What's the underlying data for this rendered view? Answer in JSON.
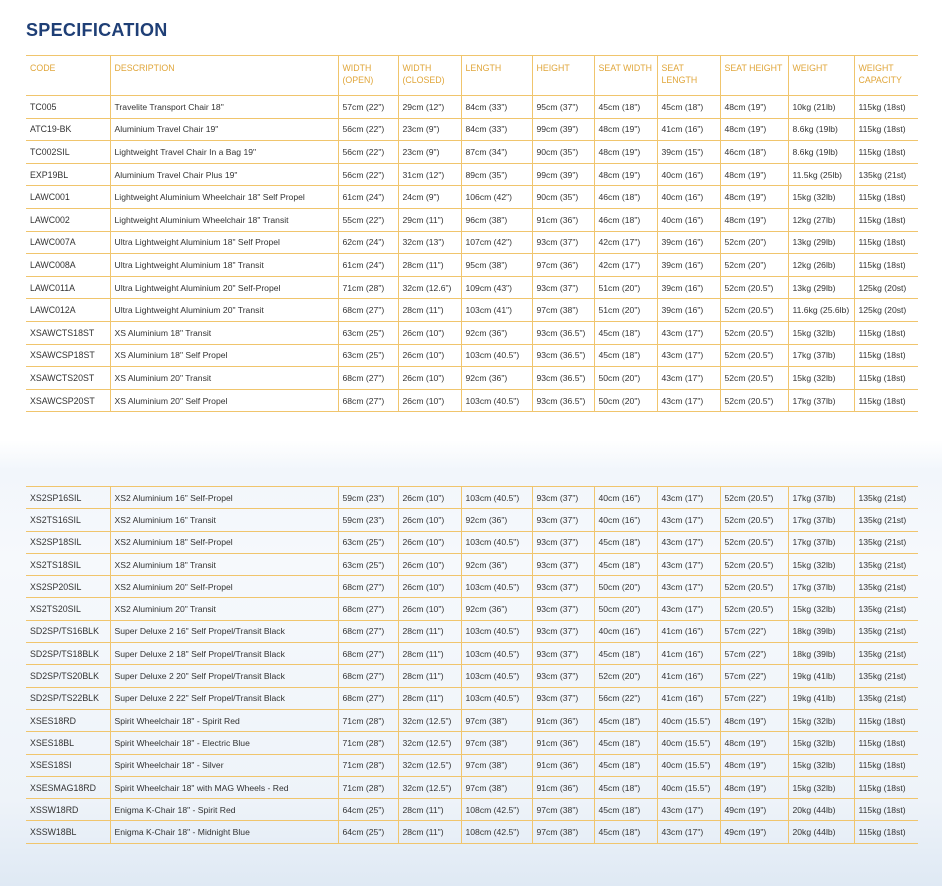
{
  "title": "SPECIFICATION",
  "headers": [
    "CODE",
    "DESCRIPTION",
    "WIDTH (OPEN)",
    "WIDTH (CLOSED)",
    "LENGTH",
    "HEIGHT",
    "SEAT WIDTH",
    "SEAT LENGTH",
    "SEAT HEIGHT",
    "WEIGHT",
    "WEIGHT CAPACITY"
  ],
  "top_rows": [
    [
      "TC005",
      "Travelite Transport Chair 18\"",
      "57cm (22\")",
      "29cm (12\")",
      "84cm (33\")",
      "95cm (37\")",
      "45cm (18\")",
      "45cm (18\")",
      "48cm (19\")",
      "10kg (21lb)",
      "115kg (18st)"
    ],
    [
      "ATC19-BK",
      "Aluminium Travel Chair 19\"",
      "56cm (22\")",
      "23cm (9\")",
      "84cm (33\")",
      "99cm (39\")",
      "48cm (19\")",
      "41cm (16\")",
      "48cm (19\")",
      "8.6kg (19lb)",
      "115kg (18st)"
    ],
    [
      "TC002SIL",
      "Lightweight Travel Chair In a Bag 19\"",
      "56cm (22\")",
      "23cm (9\")",
      "87cm (34\")",
      "90cm (35\")",
      "48cm (19\")",
      "39cm (15\")",
      "46cm (18\")",
      "8.6kg (19lb)",
      "115kg (18st)"
    ],
    [
      "EXP19BL",
      "Aluminium Travel Chair Plus 19\"",
      "56cm (22\")",
      "31cm (12\")",
      "89cm (35\")",
      "99cm (39\")",
      "48cm (19\")",
      "40cm (16\")",
      "48cm (19\")",
      "11.5kg (25lb)",
      "135kg (21st)"
    ],
    [
      "LAWC001",
      "Lightweight Aluminium Wheelchair 18\" Self Propel",
      "61cm (24\")",
      "24cm (9\")",
      "106cm (42\")",
      "90cm (35\")",
      "46cm (18\")",
      "40cm (16\")",
      "48cm (19\")",
      "15kg (32lb)",
      "115kg (18st)"
    ],
    [
      "LAWC002",
      "Lightweight Aluminium Wheelchair 18\" Transit",
      "55cm (22\")",
      "29cm (11\")",
      "96cm (38\")",
      "91cm (36\")",
      "46cm (18\")",
      "40cm (16\")",
      "48cm (19\")",
      "12kg (27lb)",
      "115kg (18st)"
    ],
    [
      "LAWC007A",
      "Ultra Lightweight Aluminium 18\" Self Propel",
      "62cm (24\")",
      "32cm (13\")",
      "107cm (42\")",
      "93cm (37\")",
      "42cm (17\")",
      "39cm (16\")",
      "52cm (20\")",
      "13kg (29lb)",
      "115kg (18st)"
    ],
    [
      "LAWC008A",
      "Ultra Lightweight Aluminium 18\" Transit",
      "61cm (24\")",
      "28cm (11\")",
      "95cm (38\")",
      "97cm (36\")",
      "42cm (17\")",
      "39cm (16\")",
      "52cm (20\")",
      "12kg (26lb)",
      "115kg (18st)"
    ],
    [
      "LAWC011A",
      "Ultra Lightweight Aluminium 20\" Self-Propel",
      "71cm (28\")",
      "32cm (12.6\")",
      "109cm (43\")",
      "93cm (37\")",
      "51cm (20\")",
      "39cm (16\")",
      "52cm (20.5\")",
      "13kg (29lb)",
      "125kg (20st)"
    ],
    [
      "LAWC012A",
      "Ultra Lightweight Aluminium 20\" Transit",
      "68cm (27\")",
      "28cm (11\")",
      "103cm (41\")",
      "97cm (38\")",
      "51cm (20\")",
      "39cm (16\")",
      "52cm (20.5\")",
      "11.6kg (25.6lb)",
      "125kg (20st)"
    ],
    [
      "XSAWCTS18ST",
      "XS Aluminium 18\" Transit",
      "63cm (25\")",
      "26cm (10\")",
      "92cm (36\")",
      "93cm (36.5\")",
      "45cm (18\")",
      "43cm (17\")",
      "52cm (20.5\")",
      "15kg (32lb)",
      "115kg (18st)"
    ],
    [
      "XSAWCSP18ST",
      "XS Aluminium 18\" Self Propel",
      "63cm (25\")",
      "26cm (10\")",
      "103cm (40.5\")",
      "93cm (36.5\")",
      "45cm (18\")",
      "43cm (17\")",
      "52cm (20.5\")",
      "17kg (37lb)",
      "115kg (18st)"
    ],
    [
      "XSAWCTS20ST",
      "XS Aluminium 20\" Transit",
      "68cm (27\")",
      "26cm (10\")",
      "92cm (36\")",
      "93cm (36.5\")",
      "50cm (20\")",
      "43cm (17\")",
      "52cm (20.5\")",
      "15kg (32lb)",
      "115kg (18st)"
    ],
    [
      "XSAWCSP20ST",
      "XS Aluminium 20\" Self Propel",
      "68cm (27\")",
      "26cm (10\")",
      "103cm (40.5\")",
      "93cm (36.5\")",
      "50cm (20\")",
      "43cm (17\")",
      "52cm (20.5\")",
      "17kg (37lb)",
      "115kg (18st)"
    ]
  ],
  "bottom_rows": [
    [
      "XS2SP16SIL",
      "XS2 Aluminium 16\" Self-Propel",
      "59cm (23\")",
      "26cm (10\")",
      "103cm (40.5\")",
      "93cm (37\")",
      "40cm (16\")",
      "43cm (17\")",
      "52cm (20.5\")",
      "17kg (37lb)",
      "135kg (21st)"
    ],
    [
      "XS2TS16SIL",
      "XS2 Aluminium 16\" Transit",
      "59cm (23\")",
      "26cm (10\")",
      "92cm (36\")",
      "93cm (37\")",
      "40cm (16\")",
      "43cm (17\")",
      "52cm (20.5\")",
      "17kg (37lb)",
      "135kg (21st)"
    ],
    [
      "XS2SP18SIL",
      "XS2 Aluminium 18\" Self-Propel",
      "63cm (25\")",
      "26cm (10\")",
      "103cm (40.5\")",
      "93cm (37\")",
      "45cm (18\")",
      "43cm (17\")",
      "52cm (20.5\")",
      "17kg (37lb)",
      "135kg (21st)"
    ],
    [
      "XS2TS18SIL",
      "XS2 Aluminium 18\" Transit",
      "63cm (25\")",
      "26cm (10\")",
      "92cm (36\")",
      "93cm (37\")",
      "45cm (18\")",
      "43cm (17\")",
      "52cm (20.5\")",
      "15kg (32lb)",
      "135kg (21st)"
    ],
    [
      "XS2SP20SIL",
      "XS2 Aluminium 20\" Self-Propel",
      "68cm (27\")",
      "26cm (10\")",
      "103cm (40.5\")",
      "93cm (37\")",
      "50cm (20\")",
      "43cm (17\")",
      "52cm (20.5\")",
      "17kg (37lb)",
      "135kg (21st)"
    ],
    [
      "XS2TS20SIL",
      "XS2 Aluminium 20\" Transit",
      "68cm (27\")",
      "26cm (10\")",
      "92cm (36\")",
      "93cm (37\")",
      "50cm (20\")",
      "43cm (17\")",
      "52cm (20.5\")",
      "15kg (32lb)",
      "135kg (21st)"
    ],
    [
      "SD2SP/TS16BLK",
      "Super Deluxe 2 16\" Self Propel/Transit Black",
      "68cm (27\")",
      "28cm (11\")",
      "103cm (40.5\")",
      "93cm (37\")",
      "40cm (16\")",
      "41cm (16\")",
      "57cm (22\")",
      "18kg (39lb)",
      "135kg (21st)"
    ],
    [
      "SD2SP/TS18BLK",
      "Super Deluxe 2 18\" Self Propel/Transit Black",
      "68cm (27\")",
      "28cm (11\")",
      "103cm (40.5\")",
      "93cm (37\")",
      "45cm (18\")",
      "41cm (16\")",
      "57cm (22\")",
      "18kg (39lb)",
      "135kg (21st)"
    ],
    [
      "SD2SP/TS20BLK",
      "Super Deluxe 2 20\" Self Propel/Transit Black",
      "68cm (27\")",
      "28cm (11\")",
      "103cm (40.5\")",
      "93cm (37\")",
      "52cm (20\")",
      "41cm (16\")",
      "57cm (22\")",
      "19kg (41lb)",
      "135kg (21st)"
    ],
    [
      "SD2SP/TS22BLK",
      "Super Deluxe 2 22\" Self Propel/Transit Black",
      "68cm (27\")",
      "28cm (11\")",
      "103cm (40.5\")",
      "93cm (37\")",
      "56cm (22\")",
      "41cm (16\")",
      "57cm (22\")",
      "19kg (41lb)",
      "135kg (21st)"
    ],
    [
      "XSES18RD",
      "Spirit Wheelchair 18\" - Spirit Red",
      "71cm (28\")",
      "32cm (12.5\")",
      "97cm (38\")",
      "91cm (36\")",
      "45cm (18\")",
      "40cm (15.5\")",
      "48cm (19\")",
      "15kg (32lb)",
      "115kg (18st)"
    ],
    [
      "XSES18BL",
      "Spirit Wheelchair 18\" - Electric Blue",
      "71cm (28\")",
      "32cm (12.5\")",
      "97cm (38\")",
      "91cm (36\")",
      "45cm (18\")",
      "40cm (15.5\")",
      "48cm (19\")",
      "15kg (32lb)",
      "115kg (18st)"
    ],
    [
      "XSES18SI",
      "Spirit Wheelchair 18\" - Silver",
      "71cm (28\")",
      "32cm (12.5\")",
      "97cm (38\")",
      "91cm (36\")",
      "45cm (18\")",
      "40cm (15.5\")",
      "48cm (19\")",
      "15kg (32lb)",
      "115kg (18st)"
    ],
    [
      "XSESMAG18RD",
      "Spirit Wheelchair 18\" with MAG Wheels - Red",
      "71cm (28\")",
      "32cm (12.5\")",
      "97cm (38\")",
      "91cm (36\")",
      "45cm (18\")",
      "40cm (15.5\")",
      "48cm (19\")",
      "15kg (32lb)",
      "115kg (18st)"
    ],
    [
      "XSSW18RD",
      "Enigma K-Chair 18\" - Spirit Red",
      "64cm (25\")",
      "28cm (11\")",
      "108cm (42.5\")",
      "97cm (38\")",
      "45cm (18\")",
      "43cm (17\")",
      "49cm (19\")",
      "20kg (44lb)",
      "115kg (18st)"
    ],
    [
      "XSSW18BL",
      "Enigma K-Chair 18\" - Midnight Blue",
      "64cm (25\")",
      "28cm (11\")",
      "108cm (42.5\")",
      "97cm (38\")",
      "45cm (18\")",
      "43cm (17\")",
      "49cm (19\")",
      "20kg (44lb)",
      "115kg (18st)"
    ]
  ]
}
